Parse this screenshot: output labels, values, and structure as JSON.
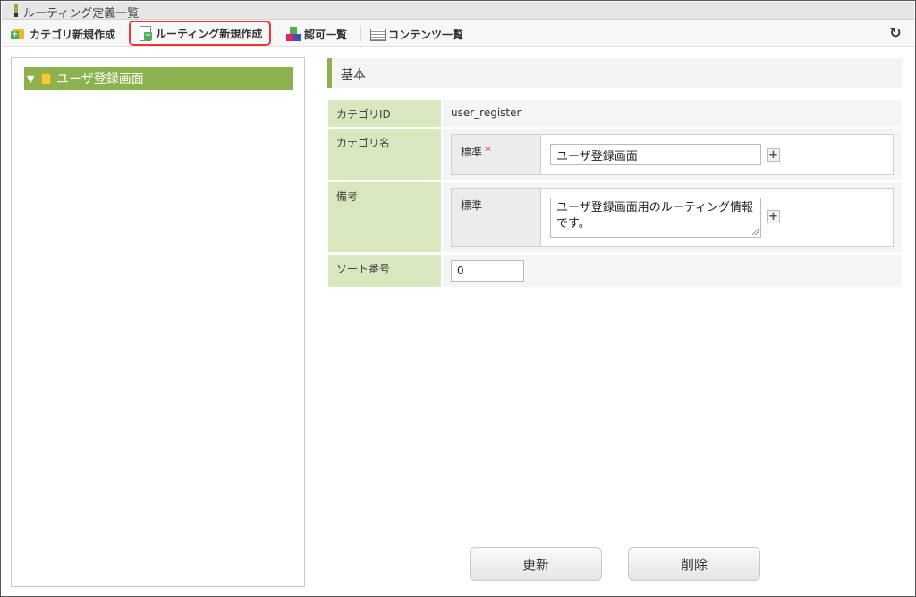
{
  "window": {
    "title": "ルーティング定義一覧"
  },
  "toolbar": {
    "items": [
      {
        "label": "カテゴリ新規作成",
        "icon": "folder-add-icon"
      },
      {
        "label": "ルーティング新規作成",
        "icon": "document-add-icon",
        "highlighted": true
      },
      {
        "label": "認可一覧",
        "icon": "blocks-icon"
      },
      {
        "label": "コンテンツ一覧",
        "icon": "list-icon"
      }
    ],
    "refresh_icon": "refresh-icon"
  },
  "tree": {
    "nodes": [
      {
        "label": "ユーザ登録画面",
        "expanded": true,
        "selected": true
      }
    ]
  },
  "section": {
    "title": "基本"
  },
  "form": {
    "category_id": {
      "label": "カテゴリID",
      "value": "user_register"
    },
    "category_name": {
      "label": "カテゴリ名",
      "sub_label": "標準",
      "required_mark": "*",
      "value": "ユーザ登録画面"
    },
    "remarks": {
      "label": "備考",
      "sub_label": "標準",
      "value": "ユーザ登録画面用のルーティング情報です。"
    },
    "sort_order": {
      "label": "ソート番号",
      "value": "0"
    }
  },
  "buttons": {
    "update": "更新",
    "delete": "削除"
  },
  "colors": {
    "accent": "#8cb24f",
    "label_bg": "#d9e7bf",
    "highlight_border": "#e53935"
  }
}
